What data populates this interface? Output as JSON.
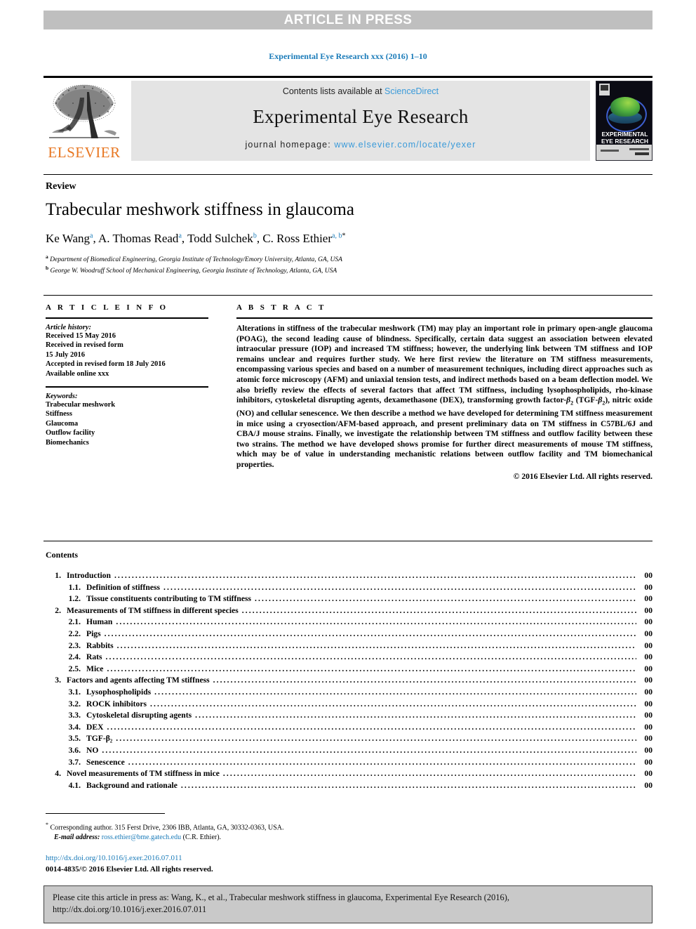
{
  "banner": {
    "text": "ARTICLE IN PRESS"
  },
  "running_head": "Experimental Eye Research xxx (2016) 1–10",
  "masthead": {
    "publisher_name": "ELSEVIER",
    "contents_prefix": "Contents lists available at ",
    "contents_link": "ScienceDirect",
    "journal_title": "Experimental Eye Research",
    "homepage_prefix": "journal homepage: ",
    "homepage_url": "www.elsevier.com/locate/yexer",
    "cover_title_line1": "EXPERIMENTAL",
    "cover_title_line2": "EYE RESEARCH"
  },
  "article": {
    "kind": "Review",
    "title": "Trabecular meshwork stiffness in glaucoma",
    "authors": [
      {
        "name": "Ke Wang",
        "marks": "a",
        "sep": ", "
      },
      {
        "name": "A. Thomas Read",
        "marks": "a",
        "sep": ", "
      },
      {
        "name": "Todd Sulchek",
        "marks": "b",
        "sep": ", "
      },
      {
        "name": "C. Ross Ethier",
        "marks": "a, b",
        "star": "*",
        "sep": ""
      }
    ],
    "affiliations": [
      {
        "mark": "a",
        "text": "Department of Biomedical Engineering, Georgia Institute of Technology/Emory University, Atlanta, GA, USA"
      },
      {
        "mark": "b",
        "text": "George W. Woodruff School of Mechanical Engineering, Georgia Institute of Technology, Atlanta, GA, USA"
      }
    ]
  },
  "info": {
    "heading": "A R T I C L E   I N F O",
    "history_title": "Article history:",
    "history": [
      "Received 15 May 2016",
      "Received in revised form",
      "15 July 2016",
      "Accepted in revised form 18 July 2016",
      "Available online xxx"
    ],
    "keywords_title": "Keywords:",
    "keywords": [
      "Trabecular meshwork",
      "Stiffness",
      "Glaucoma",
      "Outflow facility",
      "Biomechanics"
    ]
  },
  "abstract": {
    "heading": "A B S T R A C T",
    "part1": "Alterations in stiffness of the trabecular meshwork (TM) may play an important role in primary open-angle glaucoma (POAG), the second leading cause of blindness. Specifically, certain data suggest an association between elevated intraocular pressure (IOP) and increased TM stiffness; however, the underlying link between TM stiffness and IOP remains unclear and requires further study. We here first review the literature on TM stiffness measurements, encompassing various species and based on a number of measurement techniques, including direct approaches such as atomic force microscopy (AFM) and uniaxial tension tests, and indirect methods based on a beam deflection model. We also briefly review the effects of several factors that affect TM stiffness, including lysophospholipids, rho-kinase inhibitors, cytoskeletal disrupting agents, dexamethasone (DEX), transforming growth factor-",
    "beta_label": "β",
    "beta_sub": "2",
    "mid": " (TGF-",
    "mid2": "), nitric oxide (NO) and cellular senescence. We then describe a method we have developed for determining TM stiffness measurement in mice using a cryosection/AFM-based approach, and present preliminary data on TM stiffness in C57BL/6J and CBA/J mouse strains. Finally, we investigate the relationship between TM stiffness and outflow facility between these two strains. The method we have developed shows promise for further direct measurements of mouse TM stiffness, which may be of value in understanding mechanistic relations between outflow facility and TM biomechanical properties.",
    "copyright": "© 2016 Elsevier Ltd. All rights reserved."
  },
  "contents": {
    "heading": "Contents",
    "items": [
      {
        "num": "1.",
        "label": "Introduction",
        "page": "00",
        "level": 1
      },
      {
        "num": "1.1.",
        "label": "Definition of stiffness",
        "page": "00",
        "level": 2
      },
      {
        "num": "1.2.",
        "label": "Tissue constituents contributing to TM stiffness",
        "page": "00",
        "level": 2
      },
      {
        "num": "2.",
        "label": "Measurements of TM stiffness in different species",
        "page": "00",
        "level": 1
      },
      {
        "num": "2.1.",
        "label": "Human",
        "page": "00",
        "level": 2
      },
      {
        "num": "2.2.",
        "label": "Pigs",
        "page": "00",
        "level": 2
      },
      {
        "num": "2.3.",
        "label": "Rabbits",
        "page": "00",
        "level": 2
      },
      {
        "num": "2.4.",
        "label": "Rats",
        "page": "00",
        "level": 2
      },
      {
        "num": "2.5.",
        "label": "Mice",
        "page": "00",
        "level": 2
      },
      {
        "num": "3.",
        "label": "Factors and agents affecting TM stiffness",
        "page": "00",
        "level": 1
      },
      {
        "num": "3.1.",
        "label": "Lysophospholipids",
        "page": "00",
        "level": 2
      },
      {
        "num": "3.2.",
        "label": "ROCK inhibitors",
        "page": "00",
        "level": 2
      },
      {
        "num": "3.3.",
        "label": "Cytoskeletal disrupting agents",
        "page": "00",
        "level": 2
      },
      {
        "num": "3.4.",
        "label": "DEX",
        "page": "00",
        "level": 2
      },
      {
        "num": "3.5.",
        "label": "TGF-β₂",
        "page": "00",
        "level": 2
      },
      {
        "num": "3.6.",
        "label": "NO",
        "page": "00",
        "level": 2
      },
      {
        "num": "3.7.",
        "label": "Senescence",
        "page": "00",
        "level": 2
      },
      {
        "num": "4.",
        "label": "Novel measurements of TM stiffness in mice",
        "page": "00",
        "level": 1
      },
      {
        "num": "4.1.",
        "label": "Background and rationale",
        "page": "00",
        "level": 2
      }
    ]
  },
  "footnotes": {
    "corresponding": "Corresponding author. 315 Ferst Drive, 2306 IBB, Atlanta, GA, 30332-0363, USA.",
    "email_label": "E-mail address:",
    "email": "ross.ethier@bme.gatech.edu",
    "email_suffix": "(C.R. Ethier).",
    "doi": "http://dx.doi.org/10.1016/j.exer.2016.07.011",
    "issn": "0014-4835/© 2016 Elsevier Ltd. All rights reserved."
  },
  "cite_box": {
    "text": "Please cite this article in press as: Wang, K., et al., Trabecular meshwork stiffness in glaucoma, Experimental Eye Research (2016), http://dx.doi.org/10.1016/j.exer.2016.07.011"
  },
  "colors": {
    "link_blue": "#1a7bb9",
    "sciencedirect_blue": "#3a9ad9",
    "elsevier_orange": "#e87722",
    "banner_gray": "#bfbfbf",
    "band_gray": "#e4e4e4",
    "cite_gray": "#c9c9c9"
  }
}
